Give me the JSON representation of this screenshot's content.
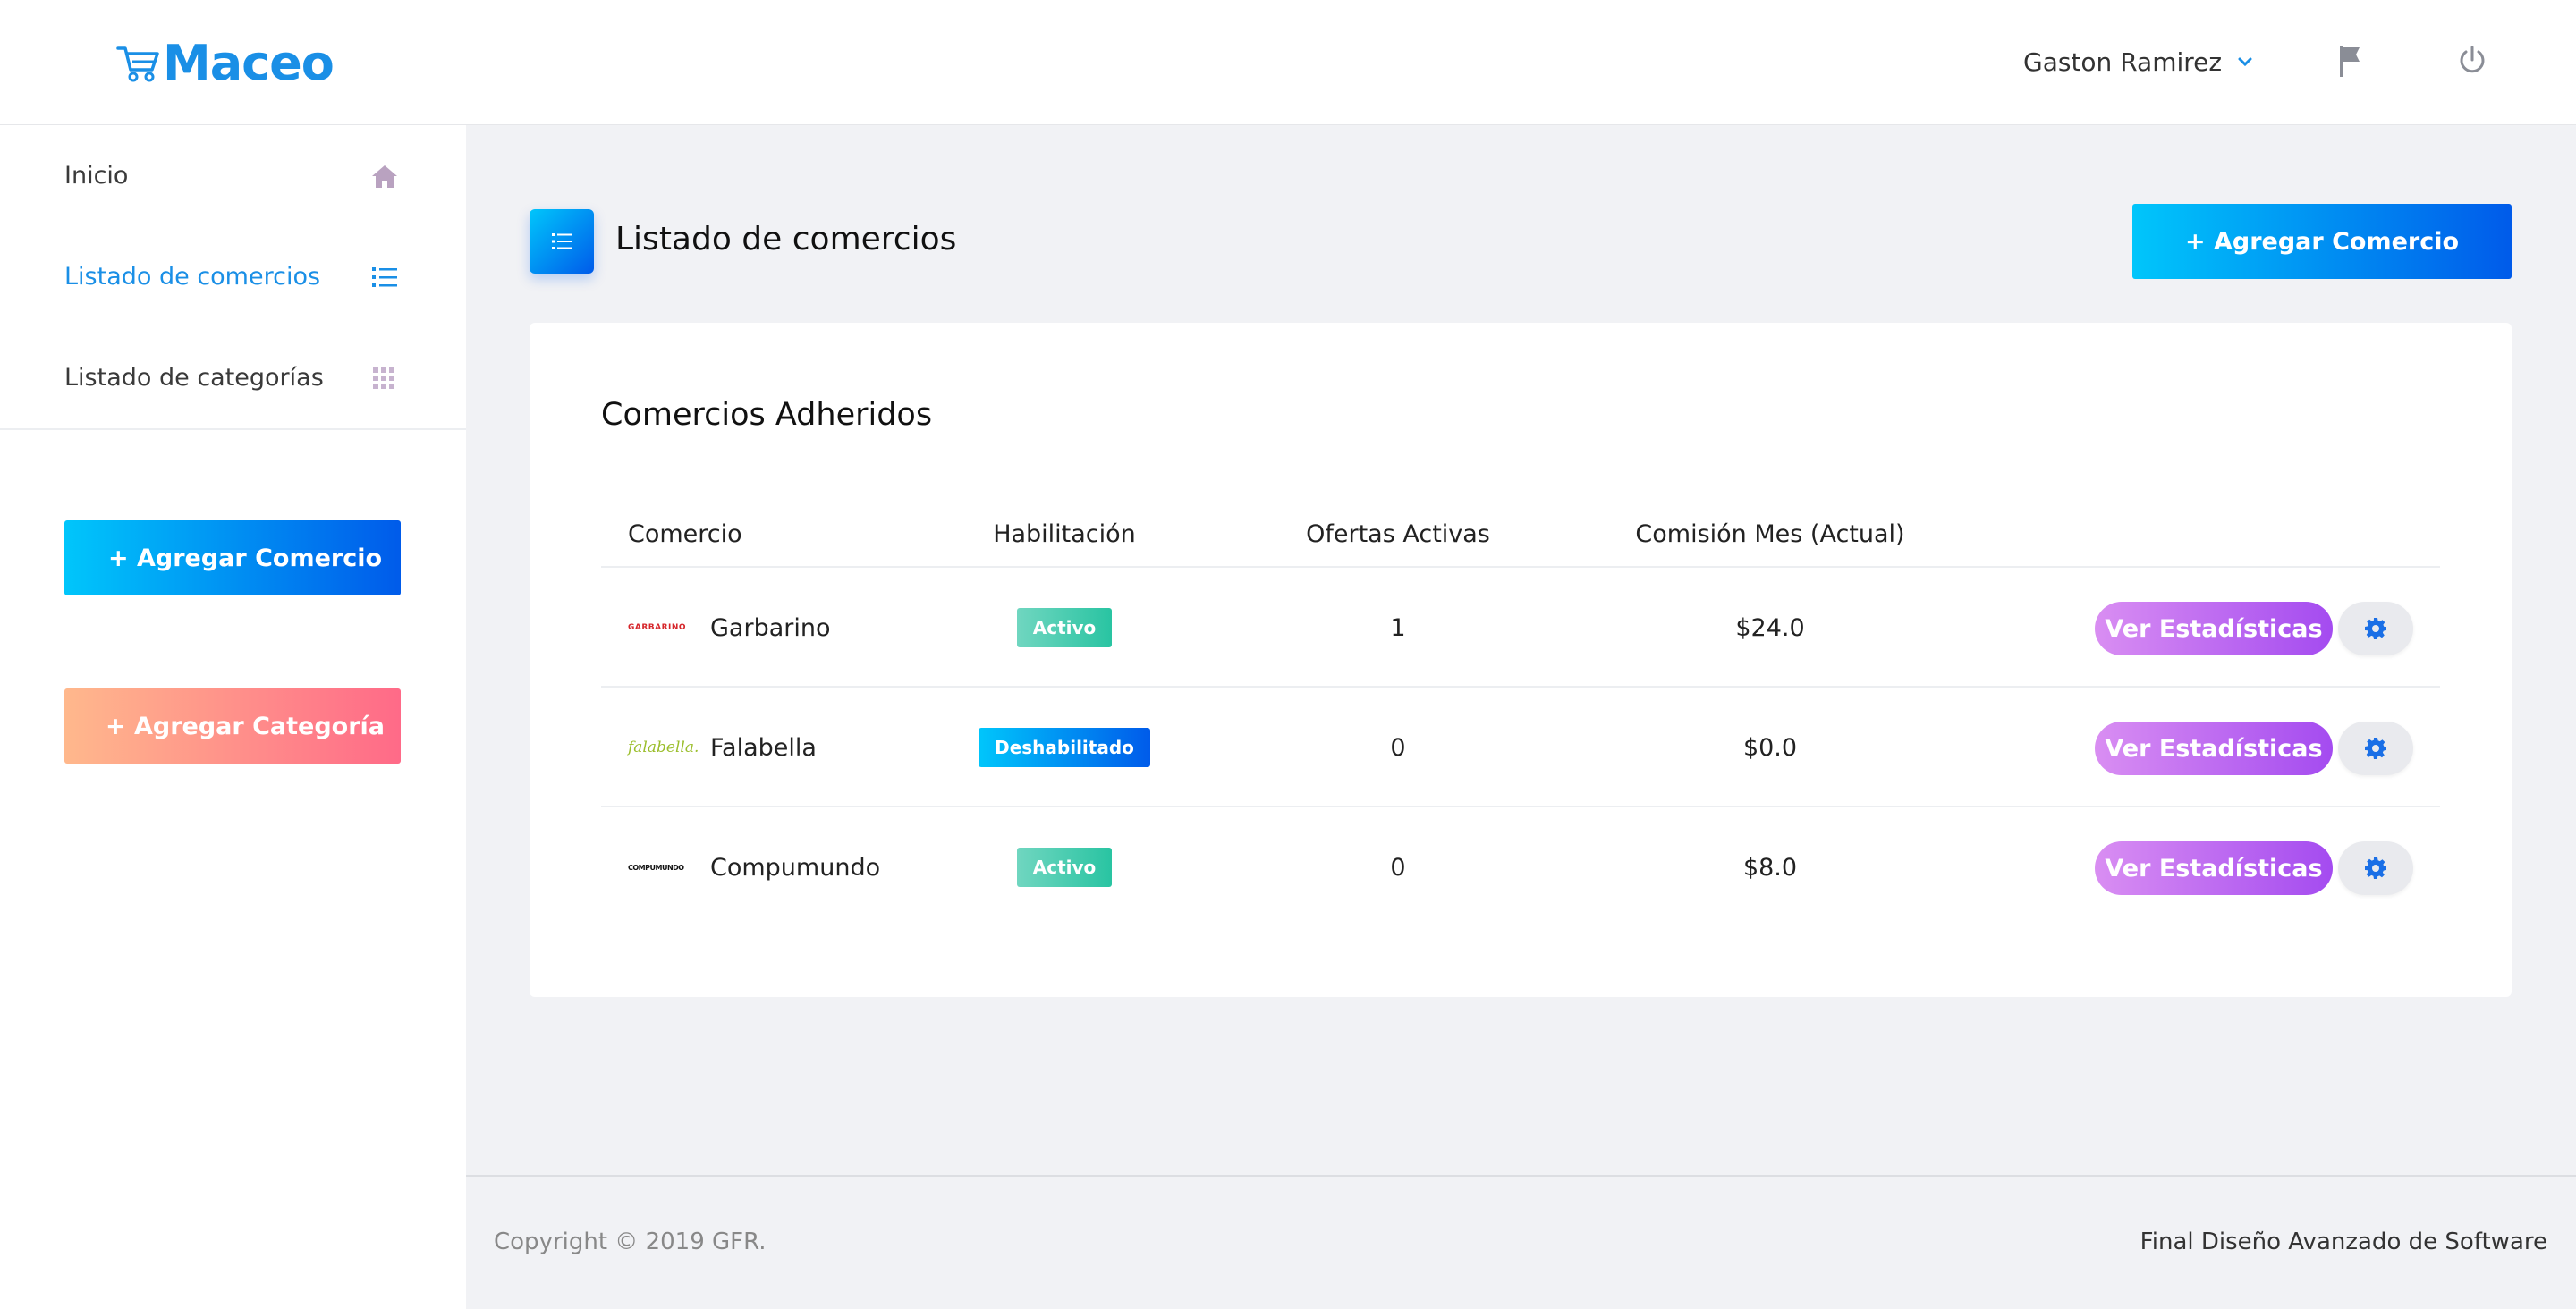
{
  "app": {
    "brand": "Maceo",
    "brand_icon": "cart-icon",
    "colors": {
      "accent": "#1a8fe6",
      "gradient_blue": [
        "#00c6fb",
        "#005bea"
      ],
      "gradient_peach": [
        "#ffb88c",
        "#ff6a88"
      ],
      "gradient_purple": [
        "#d98ef2",
        "#a44bf0"
      ],
      "gradient_green": [
        "#70d6c0",
        "#29c4a2"
      ]
    }
  },
  "header": {
    "user_name": "Gaston Ramirez",
    "user_menu_icon": "chevron-down-icon",
    "flag_icon": "flag-icon",
    "power_icon": "power-icon"
  },
  "sidebar": {
    "items": [
      {
        "label": "Inicio",
        "icon": "home-icon",
        "active": false
      },
      {
        "label": "Listado de comercios",
        "icon": "list-icon",
        "active": true
      },
      {
        "label": "Listado de categorías",
        "icon": "grid-icon",
        "active": false
      }
    ],
    "add_store_label": "+ Agregar Comercio",
    "add_category_label": "+ Agregar Categoría"
  },
  "page": {
    "title": "Listado de comercios",
    "title_icon": "list-icon",
    "add_store_label": "+ Agregar Comercio"
  },
  "card": {
    "title": "Comercios Adheridos",
    "columns": [
      "Comercio",
      "Habilitación",
      "Ofertas Activas",
      "Comisión Mes (Actual)"
    ],
    "rows": [
      {
        "logo_text": "GARBARINO",
        "name": "Garbarino",
        "status": "Activo",
        "offers": "1",
        "commission": "$24.0",
        "stats_label": "Ver Estadísticas"
      },
      {
        "logo_text": "falabella.",
        "name": "Falabella",
        "status": "Deshabilitado",
        "offers": "0",
        "commission": "$0.0",
        "stats_label": "Ver Estadísticas"
      },
      {
        "logo_text": "COMPUMUNDO",
        "name": "Compumundo",
        "status": "Activo",
        "offers": "0",
        "commission": "$8.0",
        "stats_label": "Ver Estadísticas"
      }
    ]
  },
  "footer": {
    "copyright": "Copyright © 2019 GFR.",
    "right_text": "Final Diseño Avanzado de Software"
  }
}
